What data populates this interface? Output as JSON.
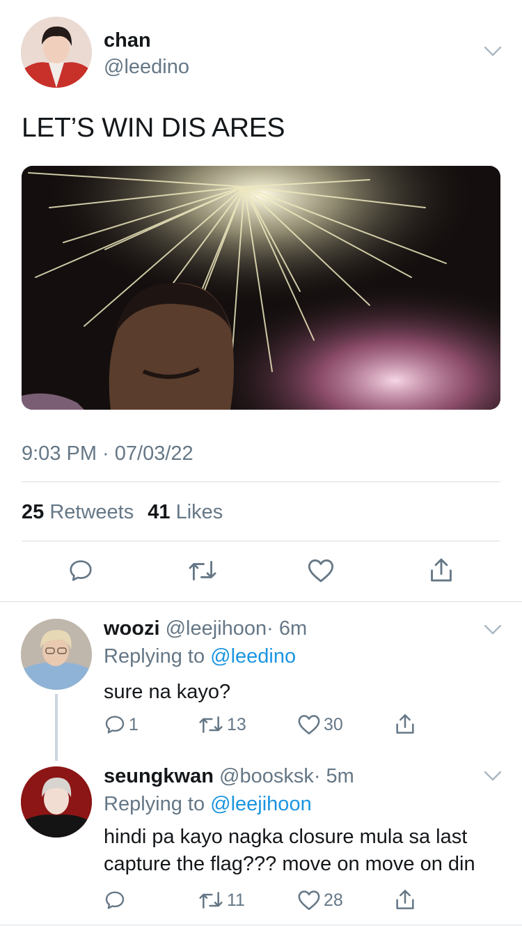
{
  "main_tweet": {
    "author": {
      "name": "chan",
      "handle": "@leedino"
    },
    "text": "LET’S WIN DIS ARES",
    "timestamp": "9:03 PM · 07/03/22",
    "stats": {
      "retweets_count": "25",
      "retweets_label": "Retweets",
      "likes_count": "41",
      "likes_label": "Likes"
    },
    "actions": [
      "reply-icon",
      "retweet-icon",
      "like-icon",
      "share-icon"
    ]
  },
  "replies": [
    {
      "name": "woozi",
      "handle": "@leejihoon",
      "time": "· 6m",
      "replying_label": "Replying to",
      "replying_to": "@leedino",
      "text": "sure na kayo?",
      "reply_count": "1",
      "retweet_count": "13",
      "like_count": "30"
    },
    {
      "name": "seungkwan",
      "handle": "@boosksk",
      "time": "· 5m",
      "replying_label": "Replying to",
      "replying_to": "@leejihoon",
      "text": "hindi pa kayo nagka closure mula sa last capture the flag??? move on move on din",
      "reply_count": "",
      "retweet_count": "11",
      "like_count": "28"
    }
  ],
  "colors": {
    "text": "#14171a",
    "secondary": "#657786",
    "link": "#1b95e0",
    "divider": "#d9dfe3"
  }
}
